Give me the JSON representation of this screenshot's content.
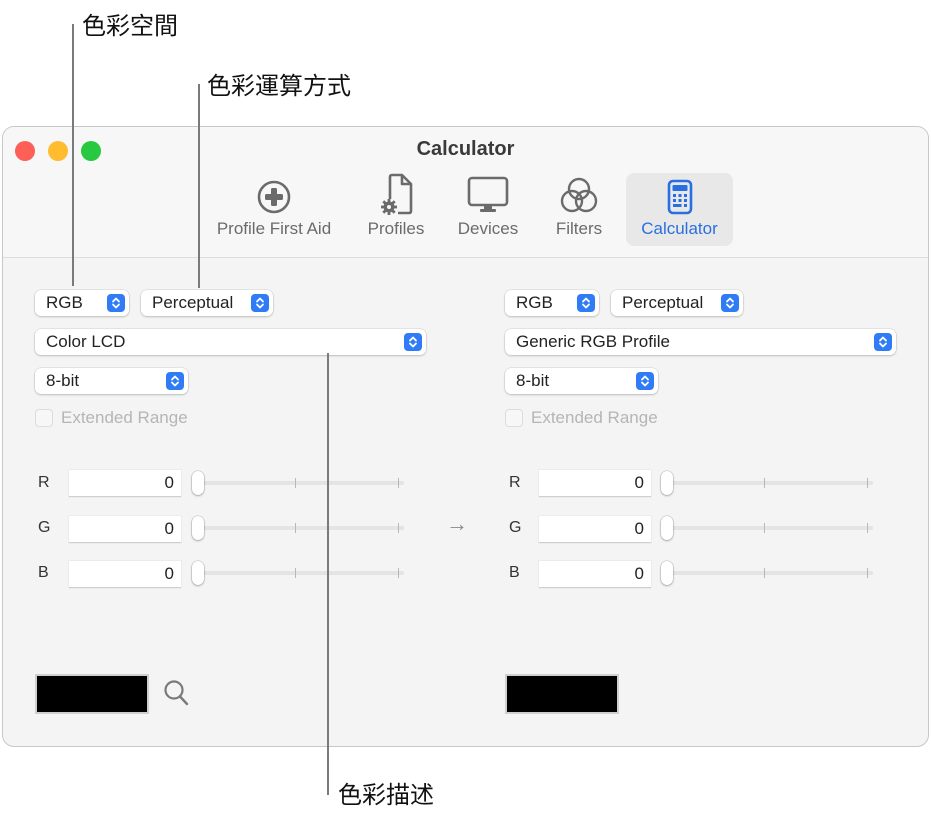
{
  "callouts": {
    "color_space": "色彩空間",
    "rendering_intent": "色彩運算方式",
    "color_profile": "色彩描述"
  },
  "window": {
    "title": "Calculator",
    "traffic_lights": {
      "close": "#fe5f57",
      "minimize": "#febc2e",
      "zoom": "#28c840"
    }
  },
  "tabs": [
    {
      "label": "Profile First Aid",
      "icon": "plus-circle-icon",
      "active": false
    },
    {
      "label": "Profiles",
      "icon": "document-gear-icon",
      "active": false
    },
    {
      "label": "Devices",
      "icon": "monitor-icon",
      "active": false
    },
    {
      "label": "Filters",
      "icon": "filters-circles-icon",
      "active": false
    },
    {
      "label": "Calculator",
      "icon": "calculator-icon",
      "active": true
    }
  ],
  "accent_color": "#2f7cf6",
  "source": {
    "color_space": "RGB",
    "rendering_intent": "Perceptual",
    "profile": "Color LCD",
    "bit_depth": "8-bit",
    "extended_range_label": "Extended Range",
    "extended_range_checked": false,
    "channels": [
      {
        "label": "R",
        "value": "0",
        "slider_fraction": 0
      },
      {
        "label": "G",
        "value": "0",
        "slider_fraction": 0
      },
      {
        "label": "B",
        "value": "0",
        "slider_fraction": 0
      }
    ],
    "swatch_color": "#000000"
  },
  "destination": {
    "color_space": "RGB",
    "rendering_intent": "Perceptual",
    "profile": "Generic RGB Profile",
    "bit_depth": "8-bit",
    "extended_range_label": "Extended Range",
    "extended_range_checked": false,
    "channels": [
      {
        "label": "R",
        "value": "0",
        "slider_fraction": 0
      },
      {
        "label": "G",
        "value": "0",
        "slider_fraction": 0
      },
      {
        "label": "B",
        "value": "0",
        "slider_fraction": 0
      }
    ],
    "swatch_color": "#000000"
  },
  "arrow": "→"
}
